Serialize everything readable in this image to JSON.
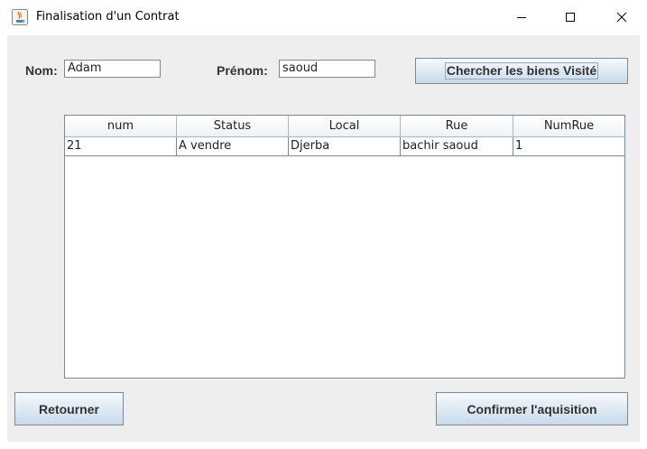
{
  "window": {
    "title": "Finalisation d'un Contrat",
    "controls": {
      "minimize": "minimize",
      "maximize": "maximize",
      "close": "close"
    }
  },
  "form": {
    "nom_label": "Nom:",
    "nom_value": "Adam",
    "prenom_label": "Prénom:",
    "prenom_value": "saoud",
    "search_button": "Chercher les biens Visité"
  },
  "table": {
    "columns": [
      "num",
      "Status",
      "Local",
      "Rue",
      "NumRue"
    ],
    "rows": [
      [
        "21",
        "A vendre",
        "Djerba",
        "bachir saoud",
        "1"
      ]
    ]
  },
  "footer": {
    "back_button": "Retourner",
    "confirm_button": "Confirmer l'aquisition"
  },
  "colors": {
    "content_bg": "#eeeeee",
    "button_gradient_top": "#f6f9fc",
    "button_gradient_bottom": "#c9d9e9",
    "border": "#7a8a99"
  }
}
